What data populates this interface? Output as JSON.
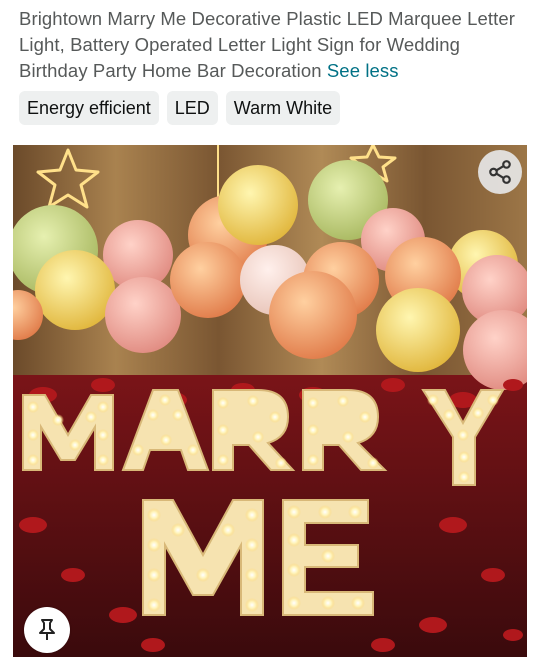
{
  "product": {
    "title": "Brightown Marry Me Decorative Plastic LED Marquee Letter Light, Battery Operated Letter Light Sign for Wedding Birthday Party Home Bar Decoration",
    "see_less_label": "See less"
  },
  "chips": [
    "Energy efficient",
    "LED",
    "Warm White"
  ],
  "image": {
    "letters_line1": "MARRY",
    "letters_line2": "ME",
    "share_icon": "share-icon",
    "pin_icon": "pin-icon"
  },
  "colors": {
    "link": "#007185",
    "title_text": "#565959",
    "chip_bg": "#eef0f0"
  }
}
